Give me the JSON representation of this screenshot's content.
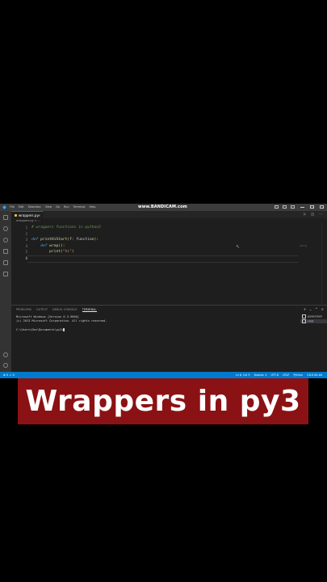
{
  "title_bar": {
    "menu": [
      "File",
      "Edit",
      "Selection",
      "View",
      "Go",
      "Run",
      "Terminal",
      "Help"
    ],
    "watermark": "www.BANDICAM.com"
  },
  "tab": {
    "filename": "wrappers.py",
    "close": "×"
  },
  "breadcrumb": "wrappers.py > ...",
  "editor": {
    "line_numbers": [
      "1",
      "2",
      "3",
      "4",
      "5",
      "6"
    ],
    "active_line": "6",
    "line1": "# wrappers functions in python3",
    "l3_kw": "def",
    "l3_name": "printHiStart",
    "l3_open": "(",
    "l3_param": "f: function",
    "l3_close": "):",
    "l4_indent": "    ",
    "l4_kw": "def",
    "l4_name": "wrap",
    "l4_rest": "():",
    "l5_indent": "        ",
    "l5_fn": "print",
    "l5_open": "(",
    "l5_str": "\"hi\"",
    "l5_close": ")",
    "ghost": "def f()"
  },
  "panel": {
    "tabs": [
      "PROBLEMS",
      "OUTPUT",
      "DEBUG CONSOLE",
      "TERMINAL"
    ],
    "active_tab": "TERMINAL",
    "terminal_lines": [
      "Microsoft Windows [Version 6.3.9600]",
      "(c) 2013 Microsoft Corporation. All rights reserved.",
      "",
      "C:\\Users\\Dev\\Documents\\py3>"
    ],
    "terminal_list": [
      "powershell",
      "cmd"
    ],
    "selected_terminal": "cmd"
  },
  "status": {
    "left": "⊗ 0 ⚠ 0",
    "right": [
      "Ln 6, Col 9",
      "Spaces: 4",
      "UTF-8",
      "CRLF",
      "Python",
      "3.8.0 64-bit"
    ]
  },
  "banner": {
    "text": "Wrappers in py3",
    "color": "#8b1214"
  },
  "colors": {
    "statusbar": "#007acc",
    "editor_bg": "#1e1e1e",
    "activity_bar": "#333333"
  }
}
